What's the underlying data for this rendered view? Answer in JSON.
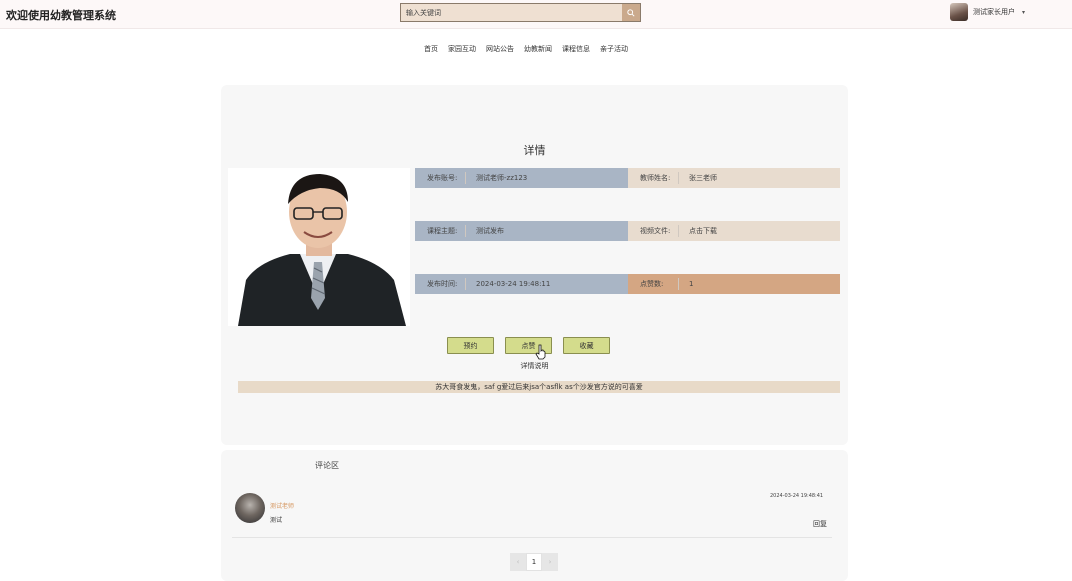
{
  "header": {
    "site_title": "欢迎使用幼教管理系统",
    "search_placeholder": "输入关键词",
    "search_icon": "search-icon",
    "user_name": "测试家长用户",
    "user_caret": "▾"
  },
  "nav": {
    "items": [
      "首页",
      "家园互动",
      "网站公告",
      "幼教新闻",
      "课程信息",
      "亲子活动"
    ]
  },
  "detail": {
    "title": "详情",
    "fields": {
      "publisher_account": {
        "label": "发布账号:",
        "value": "测试老师-zz123"
      },
      "teacher_name": {
        "label": "教师姓名:",
        "value": "张三老师"
      },
      "course_topic": {
        "label": "课程主题:",
        "value": "测试发布"
      },
      "video_file": {
        "label": "视频文件:",
        "value": "点击下载"
      },
      "publish_time": {
        "label": "发布时间:",
        "value": "2024-03-24 19:48:11"
      },
      "like_count": {
        "label": "点赞数:",
        "value": "1"
      }
    },
    "buttons": {
      "reserve": "预约",
      "like": "点赞",
      "favorite": "收藏"
    },
    "description_label": "详情说明",
    "description_text": "苏大哥食发鬼，saf g爱过后来jsa个asflk as个沙发官方说的可喜爱"
  },
  "comments": {
    "heading": "评论区",
    "items": [
      {
        "user": "测试老师",
        "text": "测试",
        "time": "2024-03-24 19:48:41",
        "reply": "回复"
      }
    ],
    "pager": {
      "prev": "‹",
      "page": "1",
      "next": "›"
    }
  },
  "colors": {
    "field_blue": "#a9b5c5",
    "field_beige": "#e8dccf",
    "field_orange": "#d4a683",
    "button_green": "#d4dc8c",
    "search_bg": "#efe0d2",
    "accent_username": "#d4935a"
  }
}
